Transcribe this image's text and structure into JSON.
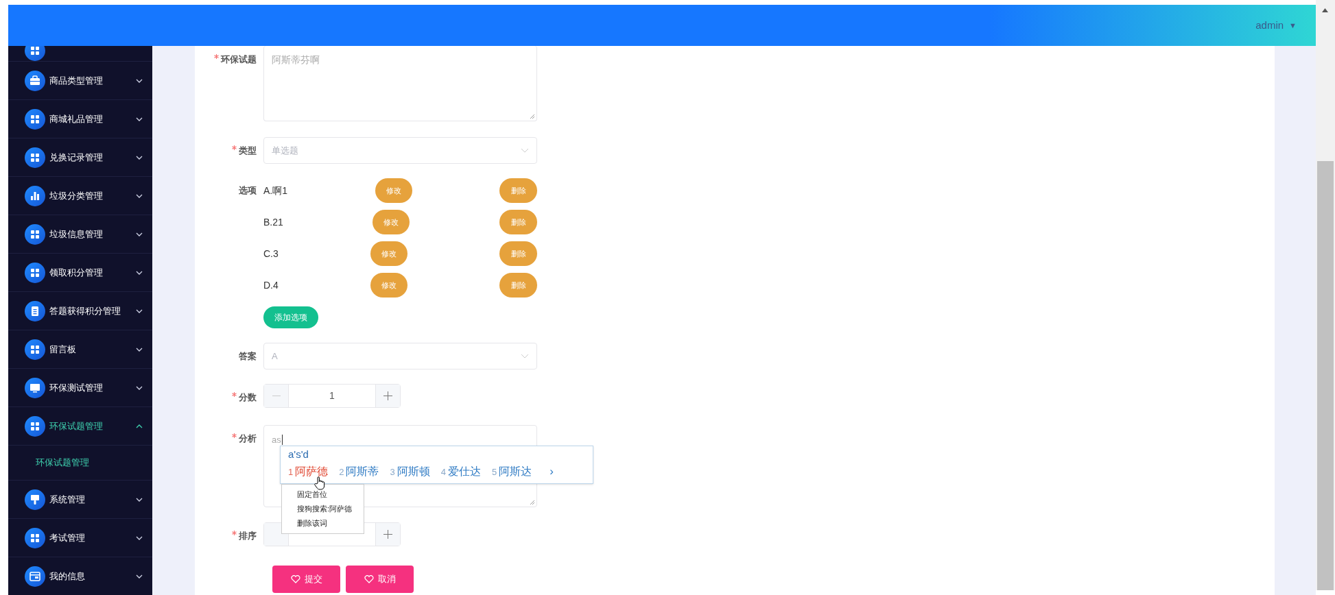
{
  "header": {
    "user": "admin",
    "caret": "▼"
  },
  "sidebar": {
    "items": [
      {
        "label": "商品类型管理",
        "expanded": false
      },
      {
        "label": "商城礼品管理",
        "expanded": false
      },
      {
        "label": "兑换记录管理",
        "expanded": false
      },
      {
        "label": "垃圾分类管理",
        "expanded": false
      },
      {
        "label": "垃圾信息管理",
        "expanded": false
      },
      {
        "label": "领取积分管理",
        "expanded": false
      },
      {
        "label": "答题获得积分管理",
        "expanded": false
      },
      {
        "label": "留言板",
        "expanded": false
      },
      {
        "label": "环保测试管理",
        "expanded": false
      },
      {
        "label": "环保试题管理",
        "expanded": true,
        "children": [
          {
            "label": "环保试题管理",
            "selected": true
          }
        ]
      },
      {
        "label": "系统管理",
        "expanded": false
      },
      {
        "label": "考试管理",
        "expanded": false
      },
      {
        "label": "我的信息",
        "expanded": false
      }
    ]
  },
  "form": {
    "fields": [
      {
        "kind": "textarea",
        "label": "环保试题",
        "required": true,
        "value": "阿斯蒂芬啊"
      },
      {
        "kind": "select",
        "label": "类型",
        "required": true,
        "value": "单选题"
      },
      {
        "kind": "options",
        "label": "选项",
        "required": false,
        "options": [
          {
            "text": "A.啊1",
            "edit": "修改",
            "delete": "删除"
          },
          {
            "text": "B.21",
            "edit": "修改",
            "delete": "删除"
          },
          {
            "text": "C.3",
            "edit": "修改",
            "delete": "删除"
          },
          {
            "text": "D.4",
            "edit": "修改",
            "delete": "删除"
          }
        ],
        "add": "添加选项"
      },
      {
        "kind": "select",
        "label": "答案",
        "required": false,
        "value": "A"
      },
      {
        "kind": "number",
        "label": "分数",
        "required": true,
        "value": "1"
      },
      {
        "kind": "textarea",
        "label": "分析",
        "required": true,
        "value": "as"
      },
      {
        "kind": "number_covered",
        "label": "排序",
        "required": true
      }
    ],
    "buttons": [
      {
        "label": "提交"
      },
      {
        "label": "取消"
      }
    ]
  },
  "ime": {
    "composition": "a's'd",
    "candidates": [
      {
        "index": "1",
        "text": "阿萨德",
        "selected": true
      },
      {
        "index": "2",
        "text": "阿斯蒂",
        "selected": false
      },
      {
        "index": "3",
        "text": "阿斯顿",
        "selected": false
      },
      {
        "index": "4",
        "text": "爱仕达",
        "selected": false
      },
      {
        "index": "5",
        "text": "阿斯达",
        "selected": false
      }
    ],
    "more": "›"
  },
  "context_menu": {
    "items": [
      "固定首位",
      "搜狗搜索:阿萨德",
      "删除该词"
    ]
  }
}
